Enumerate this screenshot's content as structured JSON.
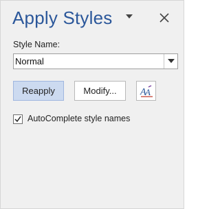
{
  "pane": {
    "title": "Apply Styles",
    "menu_icon": "chevron-down-icon",
    "close_icon": "close-icon"
  },
  "style_name": {
    "label": "Style Name:",
    "value": "Normal",
    "dropdown_icon": "chevron-down-icon"
  },
  "buttons": {
    "reapply": "Reapply",
    "modify": "Modify...",
    "style_inspector_icon": "style-inspector-icon"
  },
  "autocomplete": {
    "label": "AutoComplete style names",
    "checked": true
  },
  "colors": {
    "title": "#2b579a",
    "pane_background": "#f0f0f0",
    "reapply_background": "#ccdaf0",
    "reapply_border": "#9fb6df"
  }
}
